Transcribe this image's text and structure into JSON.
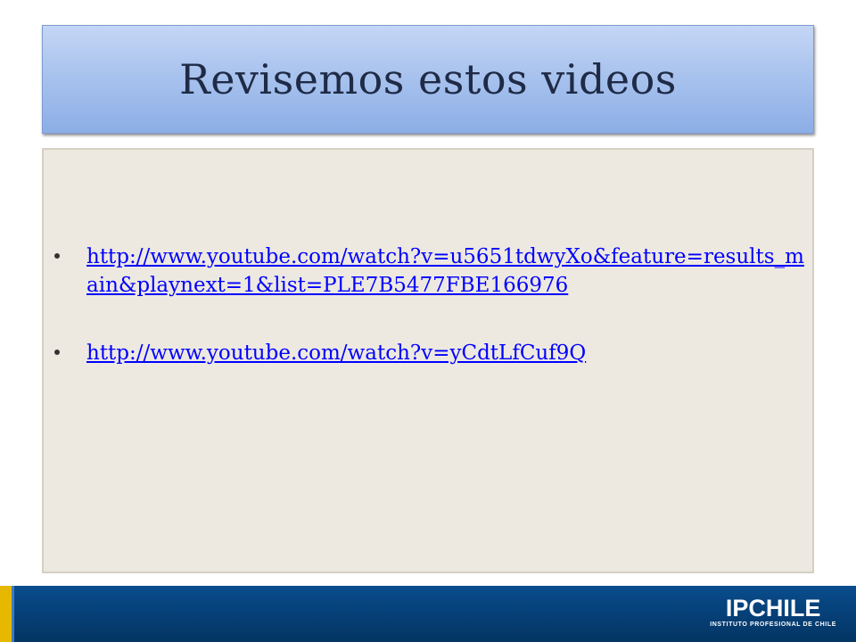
{
  "slide": {
    "title": "Revisemos estos videos",
    "links": [
      {
        "text": "http://www.youtube.com/watch?v=u5651tdwyXo&feature=results_main&playnext=1&list=PLE7B5477FBE166976"
      },
      {
        "text": "http://www.youtube.com/watch?v=yCdtLfCuf9Q"
      }
    ]
  },
  "footer": {
    "logo_main": "IPCHILE",
    "logo_sub": "INSTITUTO PROFESIONAL DE CHILE"
  },
  "colors": {
    "link": "#0000ff",
    "title_bg": "#a9c3ee",
    "content_bg": "#ede9e0",
    "footer_bg": "#06427c",
    "footer_accent": "#e6b800"
  }
}
